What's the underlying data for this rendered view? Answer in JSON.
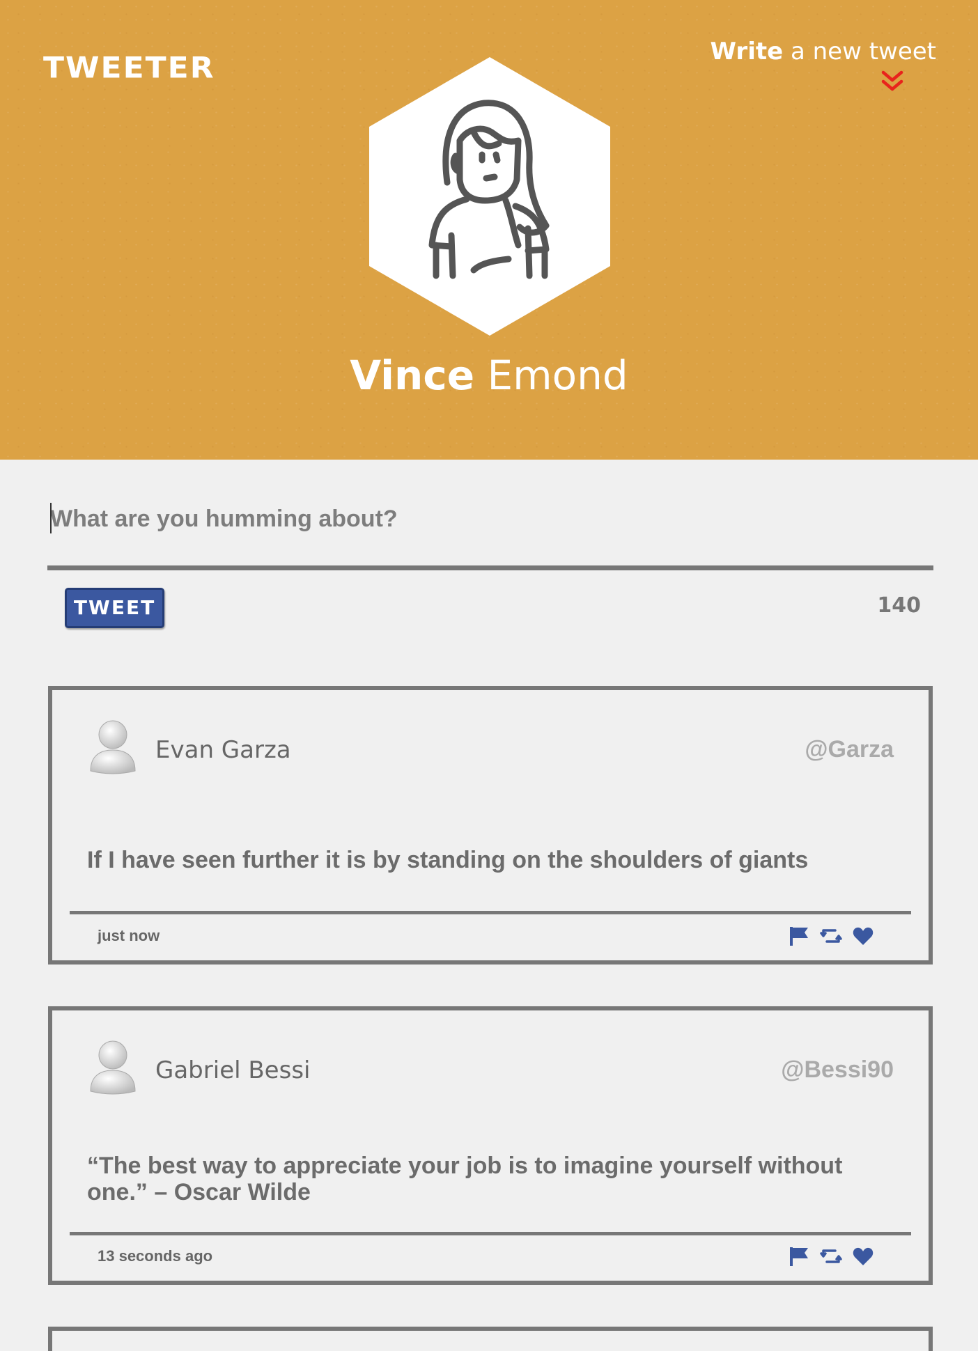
{
  "app": {
    "title": "TWEETER"
  },
  "header": {
    "compose_link_bold": "Write",
    "compose_link_rest": " a new tweet",
    "profile_first_name": "Vince",
    "profile_last_name": " Emond",
    "avatar_icon": "woman-avatar-icon",
    "accent_color": "#dca244"
  },
  "compose": {
    "placeholder": "What are you humming about?",
    "value": "",
    "button_label": "TWEET",
    "char_counter": "140",
    "button_color": "#3b58a0"
  },
  "tweets": [
    {
      "name": "Evan Garza",
      "handle": "@Garza",
      "content": "If I have seen further it is by standing on the shoulders of giants",
      "time": "just now"
    },
    {
      "name": "Gabriel Bessi",
      "handle": "@Bessi90",
      "content": "“The best way to appreciate your job is to imagine yourself without one.” – Oscar Wilde",
      "time": "13 seconds ago"
    }
  ],
  "tweet_actions": [
    "flag-icon",
    "retweet-icon",
    "heart-icon"
  ]
}
